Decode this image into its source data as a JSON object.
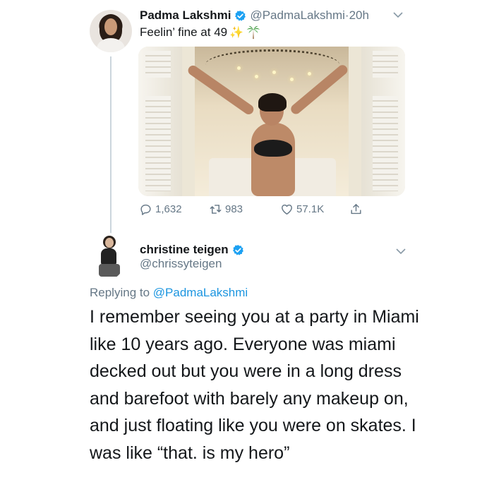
{
  "tweet": {
    "author_name": "Padma Lakshmi",
    "author_handle": "@PadmaLakshmi",
    "separator": "·",
    "time": "20h",
    "text": "Feelin’ fine at 49",
    "sparkle": "✨",
    "actions": {
      "reply_count": "1,632",
      "retweet_count": "983",
      "like_count": "57.1K"
    }
  },
  "reply": {
    "author_name": "christine teigen",
    "author_handle": "@chrissyteigen",
    "replying_prefix": "Replying to ",
    "replying_to": "@PadmaLakshmi",
    "text": "I remember seeing you at a party in Miami like 10 years ago. Everyone was miami decked out but you were in a long dress and barefoot with barely any makeup on, and just floating like you were on skates. I was like “that. is my hero”"
  },
  "colors": {
    "verified_blue": "#1da1f2",
    "muted_gray": "#657786",
    "link_blue": "#1b95e0",
    "text_dark": "#14171a"
  },
  "icons": [
    "verified-badge-icon",
    "chevron-down-icon",
    "reply-icon",
    "retweet-icon",
    "like-icon",
    "share-icon",
    "palm-tree-emoji"
  ]
}
